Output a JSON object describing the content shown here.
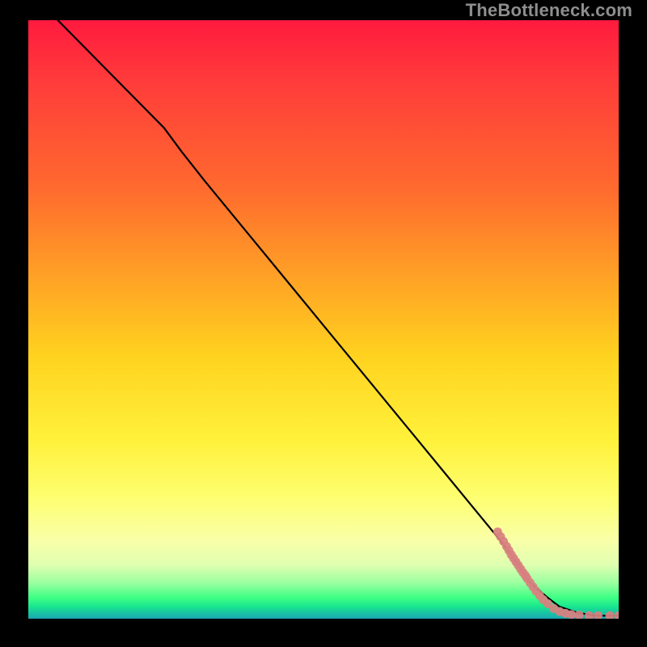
{
  "watermark": "TheBottleneck.com",
  "chart_data": {
    "type": "line",
    "title": "",
    "xlabel": "",
    "ylabel": "",
    "x_range": [
      0,
      100
    ],
    "y_range": [
      0,
      100
    ],
    "grid": false,
    "legend": false,
    "background_gradient": [
      "#ff1a3e",
      "#ff9e26",
      "#fff13a",
      "#3eff85",
      "#1aa7b0"
    ],
    "series": [
      {
        "name": "bottleneck-curve",
        "color": "#000000",
        "type": "line",
        "x": [
          5,
          10,
          15,
          20,
          23,
          26,
          30,
          35,
          40,
          45,
          50,
          55,
          60,
          65,
          70,
          75,
          80,
          83,
          85,
          88,
          90,
          93,
          96,
          100
        ],
        "y": [
          100,
          95,
          90,
          85,
          82,
          78,
          73,
          67,
          61,
          55,
          49,
          43,
          37,
          31,
          25,
          19,
          13,
          9,
          6,
          3.5,
          2,
          1,
          0.5,
          0.5
        ]
      },
      {
        "name": "data-points",
        "color": "#d88080",
        "type": "scatter",
        "x": [
          79.5,
          80,
          80.5,
          81,
          81.4,
          81.8,
          82.2,
          82.6,
          83,
          83.4,
          83.8,
          84.2,
          84.5,
          85,
          85.5,
          86,
          86.6,
          87.2,
          88,
          89,
          90,
          91,
          92,
          93.3,
          95,
          96.5,
          98.5,
          100
        ],
        "y": [
          14.5,
          13.7,
          12.9,
          12.1,
          11.4,
          10.7,
          10.1,
          9.5,
          8.9,
          8.3,
          7.7,
          7.2,
          6.7,
          6.0,
          5.3,
          4.6,
          3.9,
          3.2,
          2.5,
          1.7,
          1.2,
          0.9,
          0.7,
          0.6,
          0.5,
          0.5,
          0.5,
          0.5
        ]
      }
    ]
  }
}
